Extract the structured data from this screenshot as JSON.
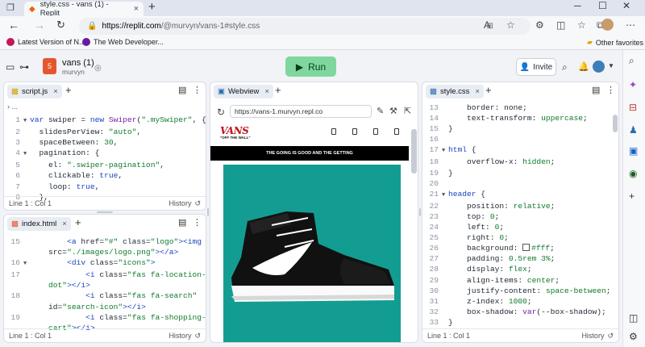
{
  "browser": {
    "tab_title": "style.css - vans (1) - Replit",
    "url_domain": "https://replit.com",
    "url_path": "/@murvyn/vans-1#style.css",
    "bookmarks": [
      "Latest Version of N...",
      "The Web Developer..."
    ],
    "other_favorites": "Other favorites"
  },
  "repl": {
    "name": "vans (1)",
    "owner": "murvyn",
    "run_label": "Run",
    "invite_label": "Invite"
  },
  "script_panel": {
    "tab": "script.js",
    "ellipsis": "...",
    "footer_pos": "Line 1 : Col 1",
    "history": "History",
    "lines": [
      {
        "n": "1",
        "fold": "▼",
        "html": "<span class='k'>var</span> swiper = <span class='k'>new</span> <span class='f'>Swiper</span>(<span class='s'>\".mySwiper\"</span>, {"
      },
      {
        "n": "2",
        "fold": "",
        "html": "  slidesPerView: <span class='s'>\"auto\"</span>,"
      },
      {
        "n": "3",
        "fold": "",
        "html": "  spaceBetween: <span class='n'>30</span>,"
      },
      {
        "n": "4",
        "fold": "▼",
        "html": "  pagination: {"
      },
      {
        "n": "5",
        "fold": "",
        "html": "    el: <span class='s'>\".swiper-pagination\"</span>,"
      },
      {
        "n": "6",
        "fold": "",
        "html": "    clickable: <span class='k'>true</span>,"
      },
      {
        "n": "7",
        "fold": "",
        "html": "    loop: <span class='k'>true</span>,"
      },
      {
        "n": "8",
        "fold": "",
        "html": "  },"
      }
    ]
  },
  "index_panel": {
    "tab": "index.html",
    "footer_pos": "Line 1 : Col 1",
    "history": "History",
    "lines": [
      {
        "n": "15",
        "fold": "",
        "html": "        <span class='k'>&lt;a</span> href=<span class='s'>\"#\"</span> class=<span class='s'>\"logo\"</span><span class='k'>&gt;&lt;img</span>"
      },
      {
        "n": "",
        "fold": "",
        "html": "    src=<span class='s'>\"./images/logo.png\"</span><span class='k'>&gt;&lt;/a&gt;</span>"
      },
      {
        "n": "16",
        "fold": "▼",
        "html": "        <span class='k'>&lt;div</span> class=<span class='s'>\"icons\"</span><span class='k'>&gt;</span>"
      },
      {
        "n": "17",
        "fold": "",
        "html": "            <span class='k'>&lt;i</span> class=<span class='s'>\"fas fa-location-</span>"
      },
      {
        "n": "",
        "fold": "",
        "html": "    <span class='s'>dot\"</span><span class='k'>&gt;&lt;/i&gt;</span>"
      },
      {
        "n": "18",
        "fold": "",
        "html": "            <span class='k'>&lt;i</span> class=<span class='s'>\"fas fa-search\"</span>"
      },
      {
        "n": "",
        "fold": "",
        "html": "    id=<span class='s'>\"search-icon\"</span><span class='k'>&gt;&lt;/i&gt;</span>"
      },
      {
        "n": "19",
        "fold": "",
        "html": "            <span class='k'>&lt;i</span> class=<span class='s'>\"fas fa-shopping-</span>"
      },
      {
        "n": "",
        "fold": "",
        "html": "    <span class='s'>cart\"</span><span class='k'>&gt;&lt;/i&gt;</span>"
      }
    ]
  },
  "webview": {
    "tab": "Webview",
    "url": "https://vans-1.murvyn.repl.co",
    "logo_text": "VANS",
    "logo_sub": "\"OFF THE WALL\"",
    "banner": "THE GOING IS GOOD AND THE GETTING",
    "hero_bg": "#139d92"
  },
  "style_panel": {
    "tab": "style.css",
    "footer_pos": "Line 1 : Col 1",
    "history": "History",
    "lines": [
      {
        "n": "13",
        "fold": "",
        "html": "    border: none;"
      },
      {
        "n": "14",
        "fold": "",
        "html": "    text-transform: <span class='s'>uppercase</span>;"
      },
      {
        "n": "15",
        "fold": "",
        "html": "}"
      },
      {
        "n": "16",
        "fold": "",
        "html": ""
      },
      {
        "n": "17",
        "fold": "▼",
        "html": "<span class='k'>html</span> {"
      },
      {
        "n": "18",
        "fold": "",
        "html": "    overflow-x: <span class='s'>hidden</span>;"
      },
      {
        "n": "19",
        "fold": "",
        "html": "}"
      },
      {
        "n": "20",
        "fold": "",
        "html": ""
      },
      {
        "n": "21",
        "fold": "▼",
        "html": "<span class='k'>header</span> {"
      },
      {
        "n": "22",
        "fold": "",
        "html": "    position: <span class='s'>relative</span>;"
      },
      {
        "n": "23",
        "fold": "",
        "html": "    top: <span class='n'>0</span>;"
      },
      {
        "n": "24",
        "fold": "",
        "html": "    left: <span class='n'>0</span>;"
      },
      {
        "n": "25",
        "fold": "",
        "html": "    right: <span class='n'>0</span>;"
      },
      {
        "n": "26",
        "fold": "",
        "html": "    background: <span class='sw'></span><span class='s'>#fff</span>;"
      },
      {
        "n": "27",
        "fold": "",
        "html": "    padding: <span class='n'>0.5rem 3%</span>;"
      },
      {
        "n": "28",
        "fold": "",
        "html": "    display: <span class='s'>flex</span>;"
      },
      {
        "n": "29",
        "fold": "",
        "html": "    align-items: <span class='s'>center</span>;"
      },
      {
        "n": "30",
        "fold": "",
        "html": "    justify-content: <span class='s'>space-between</span>;"
      },
      {
        "n": "31",
        "fold": "",
        "html": "    z-index: <span class='n'>1000</span>;"
      },
      {
        "n": "32",
        "fold": "",
        "html": "    box-shadow: <span class='f'>var</span>(--box-shadow);"
      },
      {
        "n": "33",
        "fold": "",
        "html": "}"
      }
    ]
  }
}
